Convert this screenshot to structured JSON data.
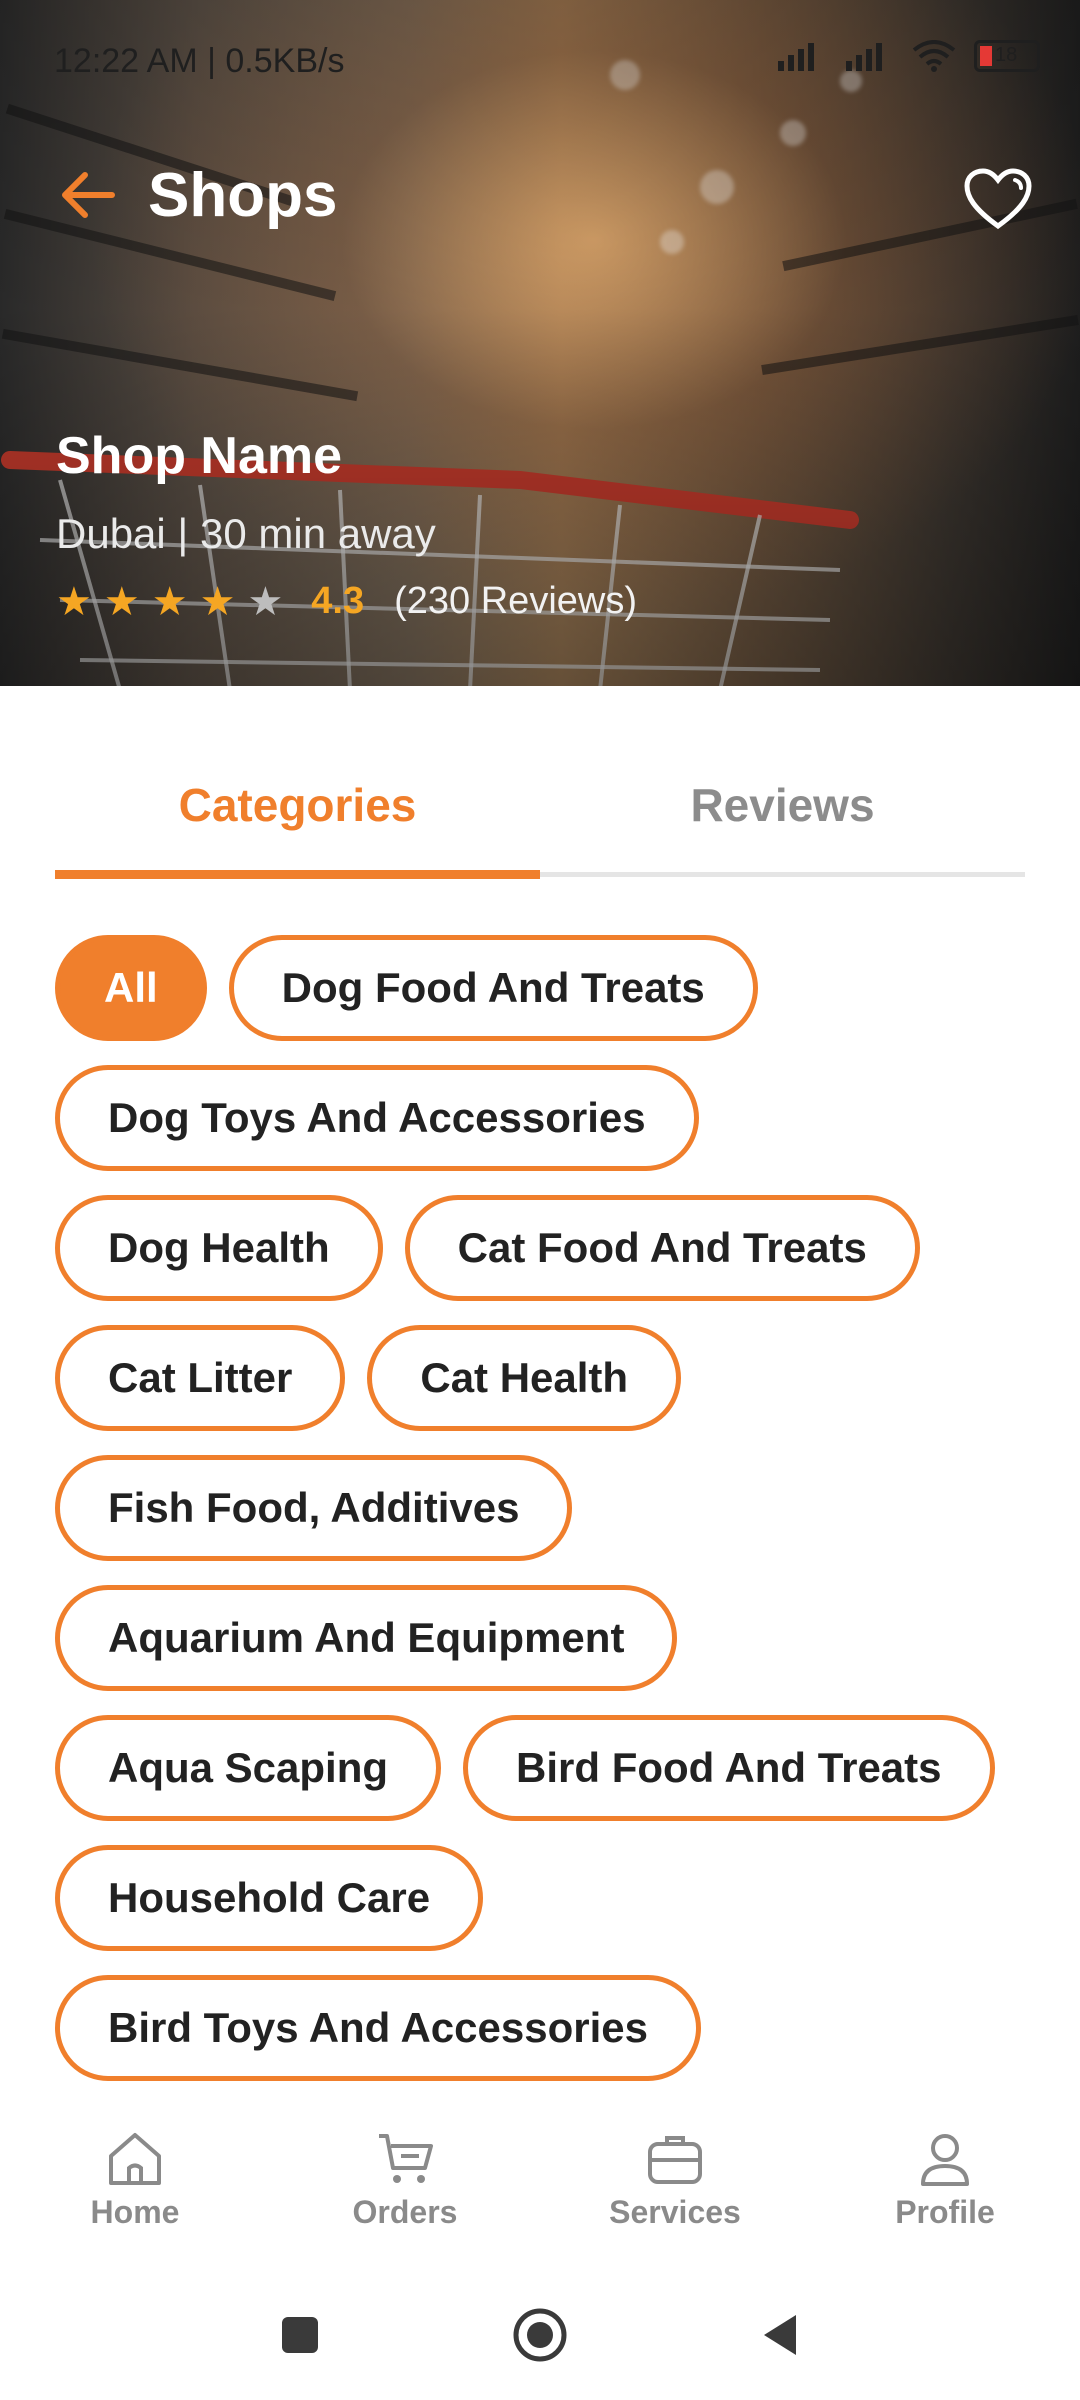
{
  "status_bar": {
    "time": "12:22 AM | 0.5KB/s",
    "battery": "18"
  },
  "header": {
    "title": "Shops"
  },
  "shop": {
    "name": "Shop Name",
    "meta": "Dubai | 30 min away",
    "rating": "4.3",
    "reviews": "(230 Reviews)",
    "stars_filled": 4,
    "stars_total": 5
  },
  "tabs": [
    {
      "label": "Categories",
      "active": true
    },
    {
      "label": "Reviews",
      "active": false
    }
  ],
  "categories": [
    "All",
    "Dog Food And Treats",
    "Dog Toys And Accessories",
    "Dog Health",
    "Cat Food And Treats",
    "Cat Litter",
    "Cat Health",
    "Fish Food, Additives",
    "Aquarium And Equipment",
    "Aqua Scaping",
    "Bird Food And Treats",
    "Household Care",
    "Bird Toys And Accessories"
  ],
  "bottom_nav": [
    {
      "label": "Home",
      "icon": "home-icon"
    },
    {
      "label": "Orders",
      "icon": "cart-icon"
    },
    {
      "label": "Services",
      "icon": "briefcase-icon"
    },
    {
      "label": "Profile",
      "icon": "person-icon"
    }
  ],
  "colors": {
    "accent": "#f07f2c",
    "star": "#f5a623"
  }
}
